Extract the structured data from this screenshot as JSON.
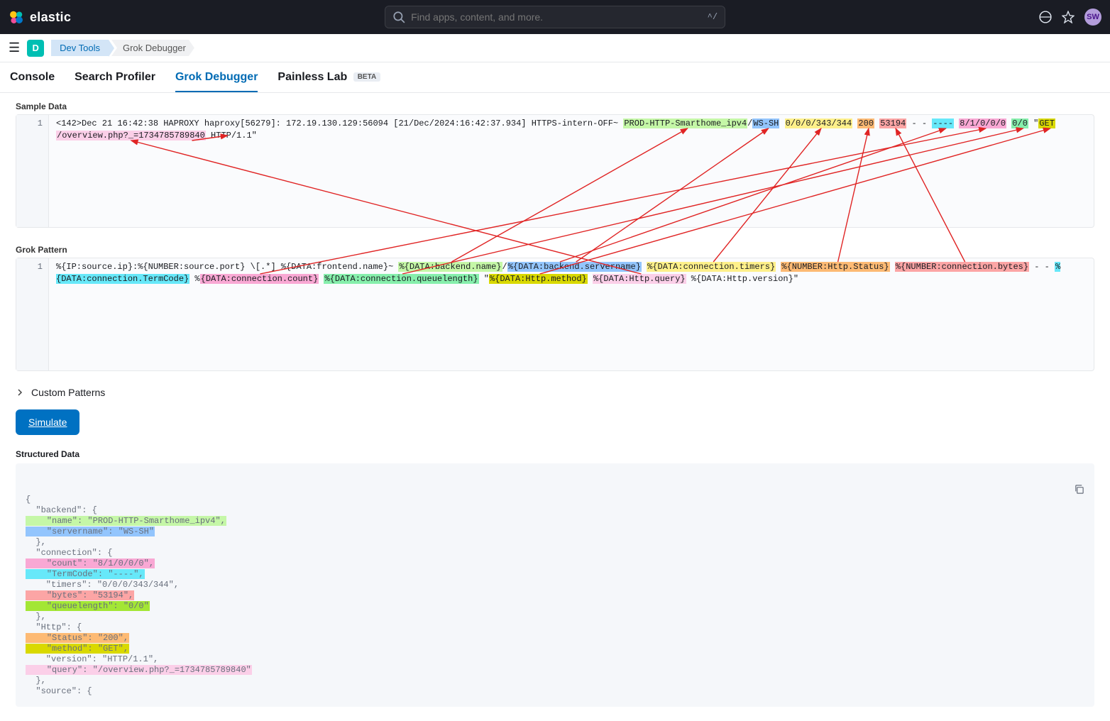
{
  "header": {
    "brand": "elastic",
    "searchPlaceholder": "Find apps, content, and more.",
    "kbd": "^/",
    "avatar": "SW"
  },
  "subbar": {
    "badge": "D",
    "crumb1": "Dev Tools",
    "crumb2": "Grok Debugger"
  },
  "tabs": {
    "console": "Console",
    "profiler": "Search Profiler",
    "grok": "Grok Debugger",
    "painless": "Painless Lab",
    "beta": "BETA"
  },
  "labels": {
    "sample": "Sample Data",
    "pattern": "Grok Pattern",
    "custom": "Custom Patterns",
    "structured": "Structured Data",
    "simulate": "Simulate",
    "lineNo": "1"
  },
  "sample": {
    "prefix": "<142>Dec 21 16:42:38 HAPROXY haproxy[56279]: 172.19.130.129:56094 [21/Dec/2024:16:42:37.934] HTTPS-intern-OFF~ ",
    "backendName": "PROD-HTTP-Smarthome_ipv4",
    "slash": "/",
    "serverName": "WS-SH",
    "timers": "0/0/0/343/344",
    "status": "200",
    "bytes": "53194",
    "dashes": " - - ",
    "termcode": "----",
    "count": "8/1/0/0/0",
    "queue": "0/0",
    "quote": " \"",
    "method": "GET",
    "space": " ",
    "query": "/overview.php?_=1734785789840",
    "tail": " HTTP/1.1\""
  },
  "pattern": {
    "p1": "%{IP:source.ip}:%{NUMBER:source.port} \\[.*] %{DATA:frontend.name}~ ",
    "p2": "%{DATA:backend.name}",
    "p2s": "/",
    "p3": "%{DATA:backend.servername}",
    "sp": " ",
    "p4": "%{DATA:connection.timers}",
    "p5": "%{NUMBER:Http.Status}",
    "p6": "%{NUMBER:connection.bytes}",
    "p6d": " - - ",
    "p7": "%{DATA:connection.TermCode}",
    "p7t": " %",
    "p8": "{DATA:connection.count}",
    "p9": "%{DATA:connection.queuelength}",
    "p9q": " \"",
    "p10": "%{DATA:Http.method}",
    "p11": "%{DATA:Http.query}",
    "p12": " %{DATA:Http.version}\""
  },
  "struct": {
    "open": "{",
    "backendKey": "  \"backend\": {",
    "bname": "    \"name\": \"PROD-HTTP-Smarthome_ipv4\",",
    "bserver": "    \"servername\": \"WS-SH\"",
    "close1": "  },",
    "connKey": "  \"connection\": {",
    "ccount": "    \"count\": \"8/1/0/0/0\",",
    "cterm": "    \"TermCode\": \"----\",",
    "ctimers": "    \"timers\": \"0/0/0/343/344\",",
    "cbytes": "    \"bytes\": \"53194\",",
    "cqueue": "    \"queuelength\": \"0/0\"",
    "httpKey": "  \"Http\": {",
    "hstatus": "    \"Status\": \"200\",",
    "hmethod": "    \"method\": \"GET\",",
    "hversion": "    \"version\": \"HTTP/1.1\",",
    "hquery": "    \"query\": \"/overview.php?_=1734785789840\"",
    "sourceKey": "  \"source\": {"
  }
}
